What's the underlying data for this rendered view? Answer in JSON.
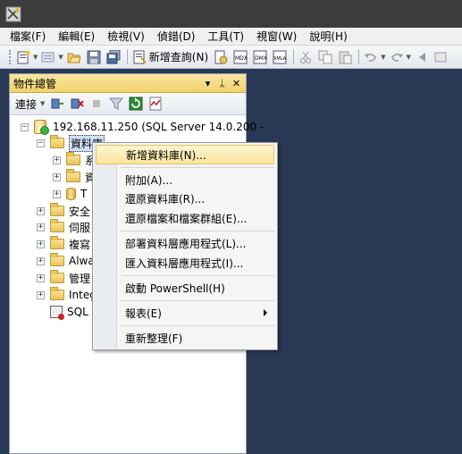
{
  "menubar": {
    "items": [
      "檔案(F)",
      "編輯(E)",
      "檢視(V)",
      "偵錯(D)",
      "工具(T)",
      "視窗(W)",
      "說明(H)"
    ]
  },
  "toolbar": {
    "new_query_label": "新增查詢(N)"
  },
  "object_explorer": {
    "title": "物件總管",
    "pin_glyph": "ᛦ",
    "dropdown_glyph": "▾",
    "close_glyph": "✕",
    "connect_label": "連接",
    "server_node": "192.168.11.250 (SQL Server 14.0.200 -",
    "databases_node": "資料庫",
    "db_child_1": "系",
    "db_child_2": "資",
    "db_child_3": "T",
    "security_node": "安全",
    "server_objects_node": "伺服",
    "replication_node": "複寫",
    "always_on_node": "Alwa",
    "management_node": "管理",
    "integration_node": "Integ",
    "sql_agent_node": "SQL"
  },
  "context_menu": {
    "items": [
      {
        "label": "新增資料庫(N)..."
      },
      {
        "label": "附加(A)..."
      },
      {
        "label": "還原資料庫(R)..."
      },
      {
        "label": "還原檔案和檔案群組(E)..."
      },
      {
        "label": "部署資料層應用程式(L)..."
      },
      {
        "label": "匯入資料層應用程式(I)..."
      },
      {
        "label": "啟動 PowerShell(H)"
      },
      {
        "label": "報表(E)"
      },
      {
        "label": "重新整理(F)"
      }
    ]
  },
  "colors": {
    "workspace_bg": "#293955",
    "panel_header": "#f2d26a",
    "menu_highlight": "#fbe6a0"
  }
}
